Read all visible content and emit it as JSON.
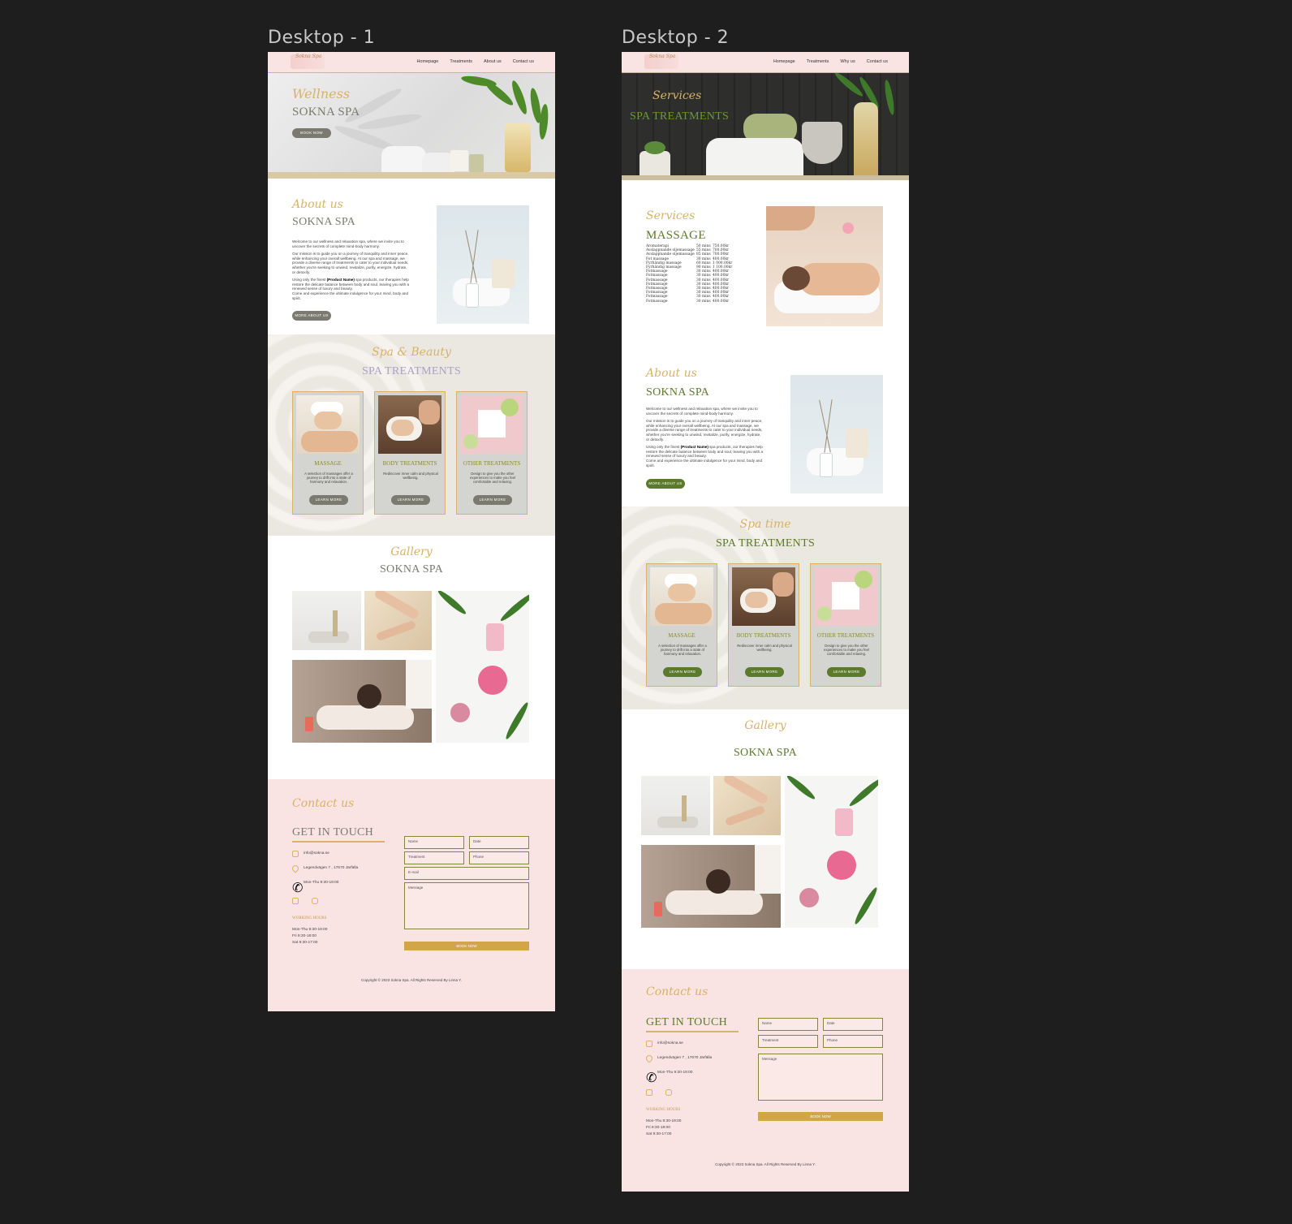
{
  "frames": [
    {
      "label": "Desktop - 1",
      "nav": {
        "logo": "Sokna Spa",
        "links": [
          "Homepage",
          "Treatments",
          "About us",
          "Contact us"
        ]
      },
      "hero": {
        "script": "Wellness",
        "title": "SOKNA SPA",
        "button": "BOOK NOW"
      },
      "about": {
        "script": "About us",
        "title": "SOKNA SPA",
        "p1": "Welcome to our wellness and relaxation spa, where we invite you to uncover the secrets of complete mind-body harmony.",
        "p2": "Our mission is to guide you on a journey of tranquility and inner peace, while enhancing your overall wellbeing. At our spa and massage, we provide a diverse range of treatments to cater to your individual needs, whether you're seeking to unwind, revitalize, purify, energize, hydrate, or detoxify.",
        "p3a": "Using only the finest ",
        "p3b": "(Product Name)",
        "p3c": " spa products, our therapies help restore the delicate balance between body and soul, leaving you with a renewed sense of luxury and beauty.",
        "p4": "Come and experience the ultimate indulgence for your mind, body and spirit.",
        "button": "MORE ABOUT US"
      },
      "treatments": {
        "script": "Spa & Beauty",
        "title": "SPA TREATMENTS",
        "cards": [
          {
            "title": "MASSAGE",
            "desc": "A selection of massages offer a journey to drift into a state of harmony and relaxation.",
            "button": "LEARN MORE"
          },
          {
            "title": "BODY TREATMENTS",
            "desc": "Rediscover inner calm and physical wellbeing.",
            "button": "LEARN MORE"
          },
          {
            "title": "OTHER TREATMENTS",
            "desc": "Design to give you the other experiences to make you feel comfortable and relaxing.",
            "button": "LEARN MORE"
          }
        ]
      },
      "gallery": {
        "script": "Gallery",
        "title": "SOKNA SPA"
      },
      "contact": {
        "script": "Contact us",
        "title": "GET IN TOUCH",
        "email": "info@sokna.se",
        "address": "Legendvägen 7 , 17670 Järfälla",
        "phone": "Mon-Thu 9:30-19:00",
        "hours_title": "WORKING HOURS",
        "hours": [
          "Mon-Thu 9:30-19:00",
          "Fri 9:30-18:00",
          "Sat 9:30-17:00"
        ],
        "fields": {
          "name": "Name",
          "date": "Date",
          "treatment": "Treatment",
          "phone": "Phone",
          "email": "E-mail",
          "message": "Message"
        },
        "button": "BOOK NOW"
      },
      "footer": "Copyright © 2023 Sokna Spa. All Rights Reserved By Linna Y."
    },
    {
      "label": "Desktop - 2",
      "nav": {
        "logo": "Sokna Spa",
        "links": [
          "Homepage",
          "Treatments",
          "Why us",
          "Contact us"
        ]
      },
      "hero": {
        "script": "Services",
        "title": "SPA TREATMENTS"
      },
      "services": {
        "script": "Services",
        "title": "MASSAGE",
        "prices": [
          {
            "name": "Aromaterapi",
            "time": "50 mins",
            "price": "750.00kr"
          },
          {
            "name": "Avslappnande oljemassage",
            "time": "55 mins",
            "price": "700.00kr"
          },
          {
            "name": "Avslappnande oljemassage",
            "time": "85 mins",
            "price": "700.00kr"
          },
          {
            "name": "Fot massage",
            "time": "30 mins",
            "price": "400.00kr"
          },
          {
            "name": "Fyrhändig massage",
            "time": "60 mins",
            "price": "1 000.00kr"
          },
          {
            "name": "Fyrhändig massage",
            "time": "90 mins",
            "price": "1 100.00kr"
          },
          {
            "name": "Fotmassage",
            "time": "30 mins",
            "price": "400.00kr"
          },
          {
            "name": "Fotmassage",
            "time": "30 mins",
            "price": "400.00kr"
          },
          {
            "name": "Fotmassage",
            "time": "30 mins",
            "price": "400.00kr"
          },
          {
            "name": "Fotmassage",
            "time": "30 mins",
            "price": "400.00kr"
          },
          {
            "name": "Fotmassage",
            "time": "30 mins",
            "price": "400.00kr"
          },
          {
            "name": "Fotmassage",
            "time": "30 mins",
            "price": "400.00kr"
          },
          {
            "name": "Fotmassage",
            "time": "30 mins",
            "price": "400.00kr"
          },
          {
            "name": "Fotmassage",
            "time": "30 mins",
            "price": "400.00kr"
          }
        ]
      },
      "about": {
        "script": "About us",
        "title": "SOKNA SPA",
        "p1": "Welcome to our wellness and relaxation spa, where we invite you to uncover the secrets of complete mind-body harmony.",
        "p2": "Our mission is to guide you on a journey of tranquility and inner peace, while enhancing your overall wellbeing. At our spa and massage, we provide a diverse range of treatments to cater to your individual needs, whether you're seeking to unwind, revitalize, purify, energize, hydrate, or detoxify.",
        "p3a": "Using only the finest ",
        "p3b": "(Product Name)",
        "p3c": " spa products, our therapies help restore the delicate balance between body and soul, leaving you with a renewed sense of luxury and beauty.",
        "p4": "Come and experience the ultimate indulgence for your mind, body and spirit.",
        "button": "MORE ABOUT US"
      },
      "treatments": {
        "script": "Spa time",
        "title": "SPA TREATMENTS",
        "cards": [
          {
            "title": "MASSAGE",
            "desc": "A selection of massages offer a journey to drift into a state of harmony and relaxation.",
            "button": "LEARN MORE"
          },
          {
            "title": "BODY TREATMENTS",
            "desc": "Rediscover inner calm and physical wellbeing.",
            "button": "LEARN MORE"
          },
          {
            "title": "OTHER TREATMENTS",
            "desc": "Design to give you the other experiences to make you feel comfortable and relaxing.",
            "button": "LEARN MORE"
          }
        ]
      },
      "gallery": {
        "script": "Gallery",
        "title": "SOKNA SPA"
      },
      "contact": {
        "script": "Contact us",
        "title": "GET IN TOUCH",
        "email": "info@sokna.se",
        "address": "Legendvägen 7 , 17670 Järfälla",
        "phone": "Mon-Thu 9:30-19:00",
        "hours_title": "WORKING HOURS",
        "hours": [
          "Mon-Thu 9:30-19:00",
          "Fri 9:30-18:00",
          "Sat 9:30-17:00"
        ],
        "fields": {
          "name": "Name",
          "date": "Date",
          "treatment": "Treatment",
          "phone": "Phone",
          "message": "Message"
        },
        "button": "BOOK NOW"
      },
      "footer": "Copyright © 2023 Sokna Spa. All Rights Reserved By Linna Y."
    }
  ],
  "colors": {
    "canvas": "#1e1e1e",
    "pink": "#f9e4e3",
    "gold": "#d8b268",
    "gray_title": "#7b7a71",
    "green": "#5b7a2c",
    "book_bar": "#d1a548"
  }
}
